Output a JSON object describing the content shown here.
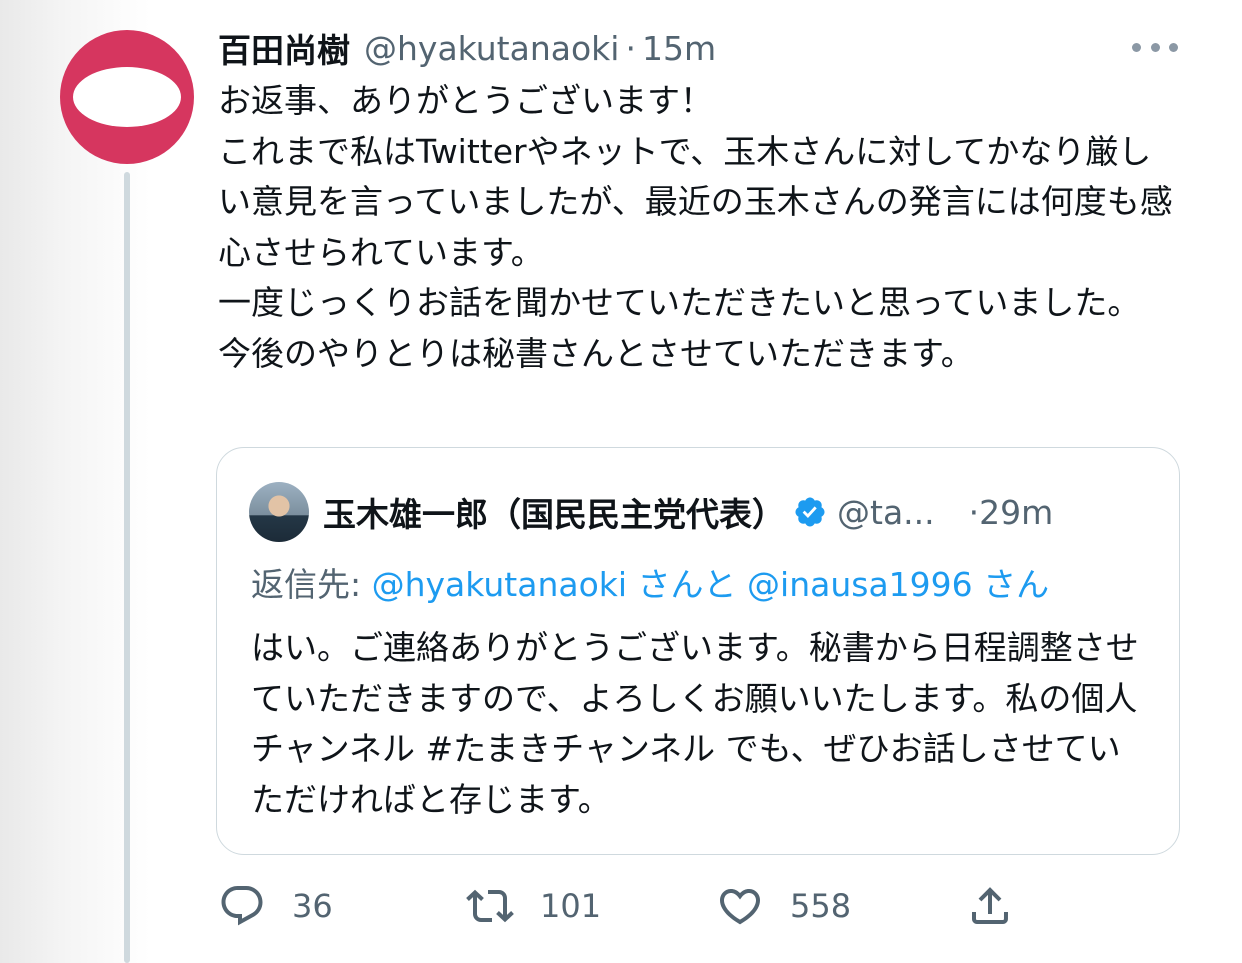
{
  "tweet": {
    "author_name": "百田尚樹",
    "handle": "@hyakutanaoki",
    "separator": "·",
    "time": "15m",
    "more_icon": "more-horizontal-icon",
    "avatar_colors": {
      "ring": "#d6365f",
      "center": "#ffffff"
    },
    "lines": [
      "お返事、ありがとうございます！",
      "これまで私はTwitterやネットで、玉木さんに対してかなり厳しい意見を言っていましたが、最近の玉木さんの発言には何度も感心させられています。",
      "一度じっくりお話を聞かせていただきたいと思っていました。",
      "今後のやりとりは秘書さんとさせていただきます。"
    ]
  },
  "quoted": {
    "author_name": "玉木雄一郎（国民民主党代表）",
    "verified_icon": "verified-badge-icon",
    "handle": "@ta...",
    "time": "·29m",
    "reply_prefix": "返信先: ",
    "reply_to_1": "@hyakutanaoki",
    "reply_conjunction": " さんと ",
    "reply_to_2": "@inausa1996",
    "reply_suffix": " さん",
    "text": "はい。ご連絡ありがとうございます。秘書から日程調整させていただきますので、よろしくお願いいたします。私の個人チャンネル #たまきチャンネル でも、ぜひお話しさせていただければと存じます。"
  },
  "actions": {
    "reply": {
      "icon": "reply-icon",
      "count": "36"
    },
    "retweet": {
      "icon": "retweet-icon",
      "count": "101"
    },
    "like": {
      "icon": "heart-icon",
      "count": "558"
    },
    "share": {
      "icon": "share-icon"
    }
  },
  "colors": {
    "link": "#1d9bf0",
    "muted": "#536471",
    "text": "#0f1419",
    "border": "#cfd9de"
  }
}
